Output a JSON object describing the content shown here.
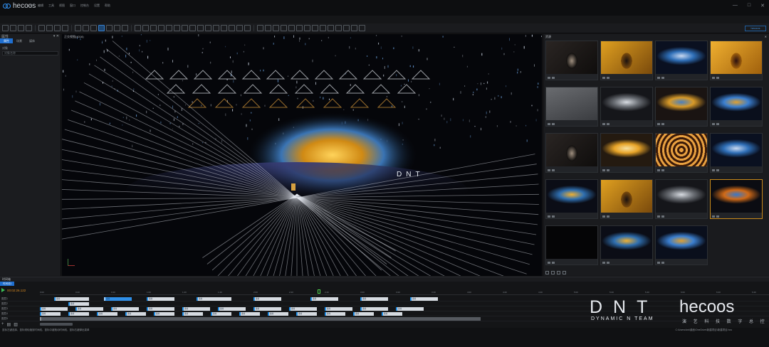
{
  "app": {
    "name": "hecoos"
  },
  "menu": [
    "文件",
    "编辑",
    "工具",
    "视图",
    "窗口",
    "控制台",
    "设置",
    "帮助"
  ],
  "window": {
    "controls": [
      "—",
      "□",
      "✕"
    ]
  },
  "toolbar": {
    "right_button": "hecoos"
  },
  "left_panel": {
    "title": "属性",
    "tabs": [
      "属性",
      "场景",
      "媒体"
    ],
    "active_tab": 0,
    "label": "对象",
    "input_placeholder": "对象名称"
  },
  "viewport": {
    "title": "正交视图(4016)",
    "stage_text": "DNT"
  },
  "right_panel": {
    "title": "资源",
    "close": "✕",
    "thumbnails": [
      {
        "scene": "figure-dark",
        "label": ""
      },
      {
        "scene": "figure-gold",
        "label": ""
      },
      {
        "scene": "dome-blue",
        "label": ""
      },
      {
        "scene": "figure-amber",
        "label": ""
      },
      {
        "scene": "gray-haze",
        "label": ""
      },
      {
        "scene": "dome-gray",
        "label": ""
      },
      {
        "scene": "dome-gold",
        "label": ""
      },
      {
        "scene": "dome-blue-stage",
        "label": ""
      },
      {
        "scene": "figure-dark",
        "label": ""
      },
      {
        "scene": "stage-gold",
        "label": ""
      },
      {
        "scene": "vortex",
        "label": ""
      },
      {
        "scene": "dome-blue",
        "label": ""
      },
      {
        "scene": "dome-blue-gold",
        "label": ""
      },
      {
        "scene": "figure-gold",
        "label": ""
      },
      {
        "scene": "dome-gray",
        "label": ""
      },
      {
        "scene": "dome-orange",
        "label": ""
      },
      {
        "scene": "black",
        "label": ""
      },
      {
        "scene": "dome-blue-gold",
        "label": ""
      },
      {
        "scene": "dome-blue-stage",
        "label": ""
      }
    ],
    "selected_index": 15
  },
  "timeline": {
    "title": "时间轴",
    "tab": "时间线1",
    "timecode": "00:02:26.122",
    "ruler": [
      "0:00",
      "0:20",
      "0:40",
      "1:00",
      "1:20",
      "1:40",
      "2:00",
      "2:20",
      "2:40",
      "3:00",
      "3:20",
      "3:40",
      "4:00",
      "4:20",
      "4:40",
      "5:00",
      "5:20",
      "5:40",
      "6:00",
      "6:20",
      "6:40"
    ],
    "tracks": [
      "图层1",
      "图层2",
      "图层3",
      "图层4",
      "图层5"
    ],
    "clips": [
      [
        {
          "start": 2,
          "dur": 5,
          "style": "",
          "text": "素材"
        },
        {
          "start": 9,
          "dur": 4,
          "style": "blue",
          "text": "素材"
        },
        {
          "start": 15,
          "dur": 4,
          "style": "",
          "text": "素材"
        },
        {
          "start": 22,
          "dur": 5,
          "style": "",
          "text": "素材"
        },
        {
          "start": 30,
          "dur": 4,
          "style": "",
          "text": "素材"
        },
        {
          "start": 38,
          "dur": 4,
          "style": "",
          "text": "素材"
        },
        {
          "start": 45,
          "dur": 4,
          "style": "",
          "text": "素材"
        },
        {
          "start": 52,
          "dur": 4,
          "style": "",
          "text": "素材"
        }
      ],
      [
        {
          "start": 4,
          "dur": 3,
          "style": "",
          "text": "素材"
        }
      ],
      [
        {
          "start": 0,
          "dur": 4,
          "style": "",
          "text": "素材"
        },
        {
          "start": 5,
          "dur": 4,
          "style": "",
          "text": "素材"
        },
        {
          "start": 10,
          "dur": 4,
          "style": "",
          "text": "素材"
        },
        {
          "start": 15,
          "dur": 4,
          "style": "",
          "text": "素材"
        },
        {
          "start": 20,
          "dur": 4,
          "style": "",
          "text": "素材"
        },
        {
          "start": 25,
          "dur": 4,
          "style": "",
          "text": "素材"
        },
        {
          "start": 30,
          "dur": 4,
          "style": "",
          "text": "素材"
        },
        {
          "start": 35,
          "dur": 4,
          "style": "",
          "text": "素材"
        },
        {
          "start": 40,
          "dur": 4,
          "style": "",
          "text": "素材"
        },
        {
          "start": 45,
          "dur": 4,
          "style": "",
          "text": "素材"
        },
        {
          "start": 50,
          "dur": 4,
          "style": "",
          "text": "素材"
        }
      ],
      [
        {
          "start": 0,
          "dur": 3,
          "style": "",
          "text": "素材"
        },
        {
          "start": 4,
          "dur": 3,
          "style": "",
          "text": "素材"
        },
        {
          "start": 8,
          "dur": 3,
          "style": "",
          "text": "素材"
        },
        {
          "start": 12,
          "dur": 3,
          "style": "",
          "text": "素材"
        },
        {
          "start": 16,
          "dur": 3,
          "style": "",
          "text": "素材"
        },
        {
          "start": 20,
          "dur": 3,
          "style": "",
          "text": "素材"
        },
        {
          "start": 24,
          "dur": 3,
          "style": "",
          "text": "素材"
        },
        {
          "start": 28,
          "dur": 3,
          "style": "",
          "text": "素材"
        },
        {
          "start": 32,
          "dur": 3,
          "style": "",
          "text": "素材"
        },
        {
          "start": 36,
          "dur": 3,
          "style": "",
          "text": "素材"
        },
        {
          "start": 40,
          "dur": 3,
          "style": "",
          "text": "素材"
        },
        {
          "start": 44,
          "dur": 3,
          "style": "",
          "text": "素材"
        },
        {
          "start": 48,
          "dur": 3,
          "style": "",
          "text": "素材"
        }
      ],
      [
        {
          "start": 0,
          "dur": 62,
          "style": "gray",
          "text": ""
        }
      ]
    ]
  },
  "status": {
    "left": "鼠标左键选择、鼠标滚轮缩放时间线、鼠标中键拖动时间线、鼠标右键弹出菜单",
    "right": "C:\\Users\\dnt\\桌面\\OneDrive\\新建项目\\新建项目.hcs"
  },
  "watermark": {
    "brand": "DNT",
    "tagline": "DYNAMIC N TEAM",
    "product": "hecoos",
    "product_cn": "演 艺 科 技 数 字 总 控"
  }
}
